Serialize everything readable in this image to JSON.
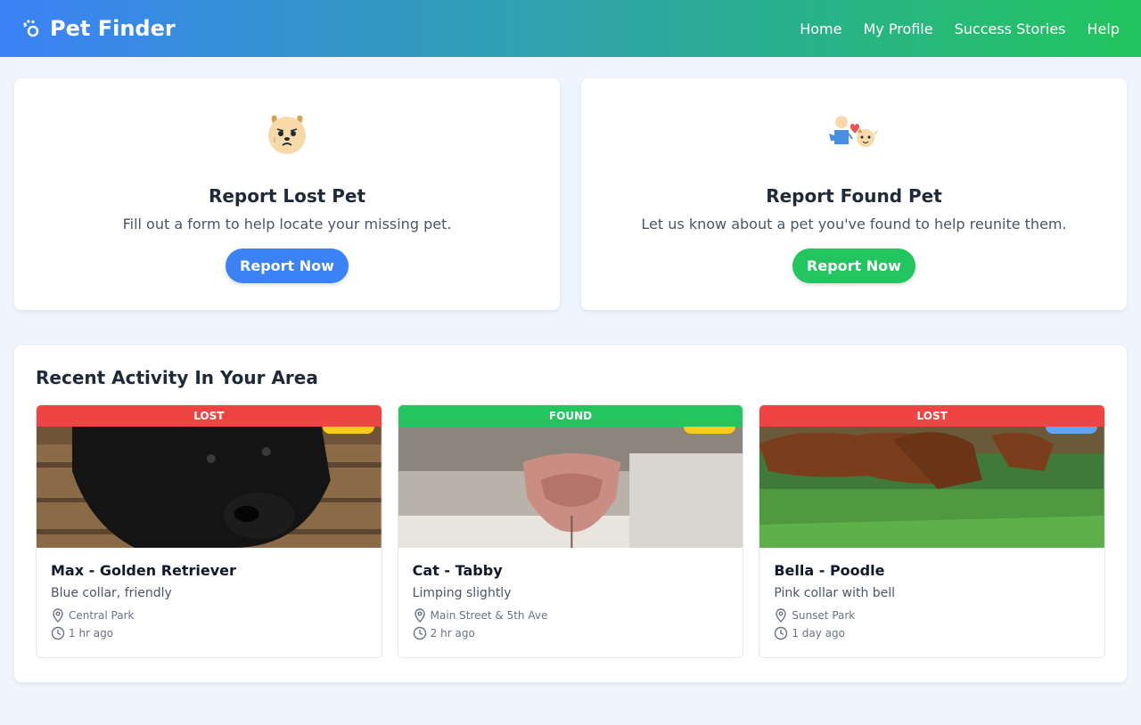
{
  "header": {
    "title": "Pet Finder",
    "brand_icon": "paw-icon",
    "nav": [
      "Home",
      "My Profile",
      "Success Stories",
      "Help"
    ],
    "colors": {
      "gradient_start": "#3b82f6",
      "gradient_end": "#22c55e"
    }
  },
  "actions": [
    {
      "icon": "sad-dog-icon",
      "title": "Report Lost Pet",
      "description": "Fill out a form to help locate your missing pet.",
      "button": "Report Now",
      "color": "#3b82f6"
    },
    {
      "icon": "person-pet-heart-icon",
      "title": "Report Found Pet",
      "description": "Let us know about a pet you've found to help reunite them.",
      "button": "Report Now",
      "color": "#22c55e"
    }
  ],
  "activity": {
    "title": "Recent Activity In Your Area",
    "pets": [
      {
        "status": "LOST",
        "status_color": "#ef4444",
        "tag_color": "#facc15",
        "image": "black-puppy-photo",
        "name": "Max - Golden Retriever",
        "description": "Blue collar, friendly",
        "location": "Central Park",
        "time": "1 hr ago"
      },
      {
        "status": "FOUND",
        "status_color": "#22c55e",
        "tag_color": "#facc15",
        "image": "cat-nose-photo",
        "name": "Cat - Tabby",
        "description": "Limping slightly",
        "location": "Main Street & 5th Ave",
        "time": "2 hr ago"
      },
      {
        "status": "LOST",
        "status_color": "#ef4444",
        "tag_color": "#60a5fa",
        "image": "dogs-on-grass-photo",
        "name": "Bella - Poodle",
        "description": "Pink collar with bell",
        "location": "Sunset Park",
        "time": "1 day ago"
      }
    ]
  }
}
